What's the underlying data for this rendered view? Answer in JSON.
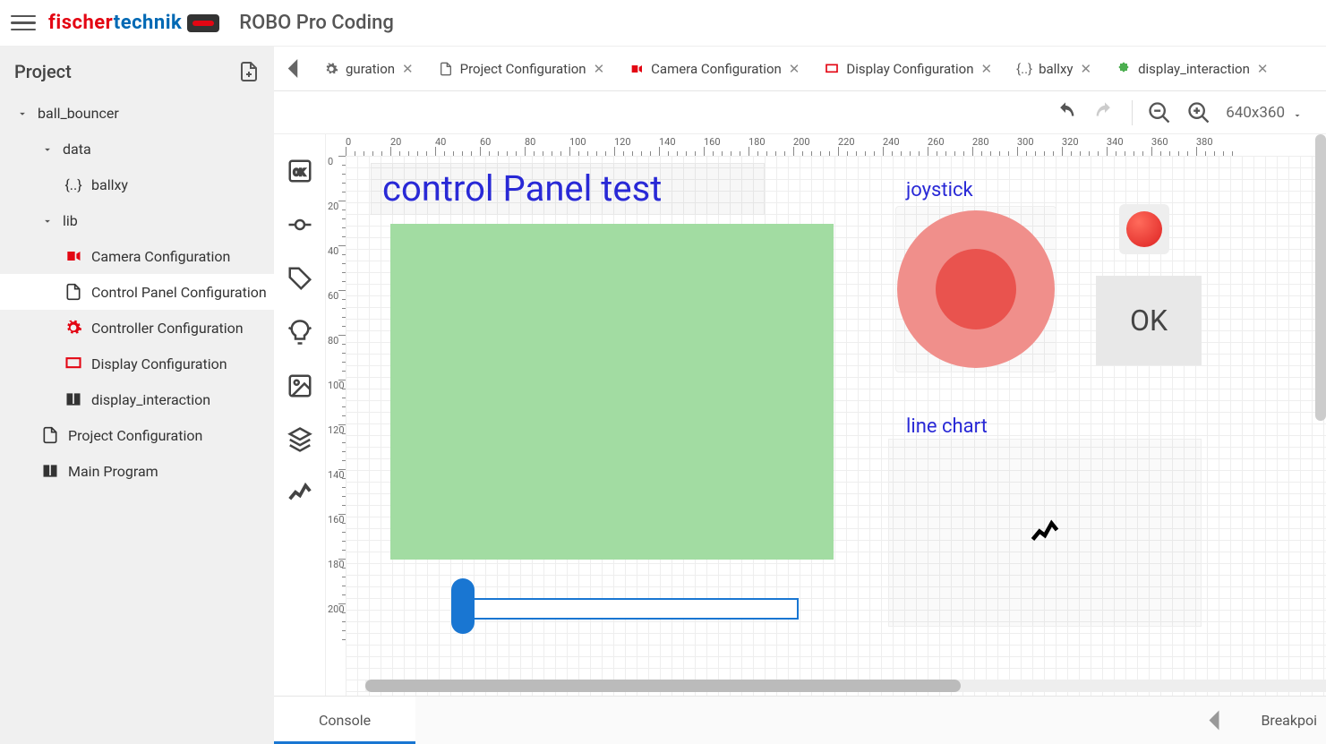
{
  "header": {
    "logo_pre": "fischer",
    "logo_post": "technik",
    "app_title": "ROBO Pro Coding"
  },
  "sidebar": {
    "title": "Project",
    "root": "ball_bouncer",
    "data_folder": "data",
    "data_items": [
      "ballxy"
    ],
    "lib_folder": "lib",
    "lib_items": [
      {
        "label": "Camera Configuration",
        "icon": "camera",
        "color": "red"
      },
      {
        "label": "Control Panel Configuration",
        "icon": "page",
        "color": "blk",
        "active": true
      },
      {
        "label": "Controller Configuration",
        "icon": "gear",
        "color": "red"
      },
      {
        "label": "Display Configuration",
        "icon": "display",
        "color": "red"
      },
      {
        "label": "display_interaction",
        "icon": "book",
        "color": "blk"
      }
    ],
    "root_items": [
      {
        "label": "Project Configuration",
        "icon": "page"
      },
      {
        "label": "Main Program",
        "icon": "book"
      }
    ]
  },
  "tabs": [
    {
      "label": "guration",
      "icon": "gear",
      "partial": true
    },
    {
      "label": "Project Configuration",
      "icon": "page"
    },
    {
      "label": "Camera Configuration",
      "icon": "camera",
      "color": "red"
    },
    {
      "label": "Display Configuration",
      "icon": "display",
      "color": "red"
    },
    {
      "label": "ballxy",
      "icon": "code"
    },
    {
      "label": "display_interaction",
      "icon": "puzzle",
      "color": "green"
    }
  ],
  "toolbar": {
    "resolution": "640x360"
  },
  "canvas": {
    "title_text": "control Panel test",
    "joystick_label": "joystick",
    "ok_label": "OK",
    "linechart_label": "line chart"
  },
  "palette": [
    "ok-box",
    "node",
    "tag",
    "bulb",
    "image",
    "stack",
    "line"
  ],
  "bottom": {
    "console": "Console",
    "breakpoints": "Breakpoi"
  },
  "ruler_h": [
    "0",
    "20",
    "40",
    "60",
    "80",
    "100",
    "120",
    "140",
    "160",
    "180",
    "200",
    "220",
    "240",
    "260",
    "280",
    "300",
    "320",
    "340",
    "360",
    "380"
  ],
  "ruler_v": [
    "0",
    "20",
    "40",
    "60",
    "80",
    "100",
    "120",
    "140",
    "160",
    "180",
    "200"
  ]
}
